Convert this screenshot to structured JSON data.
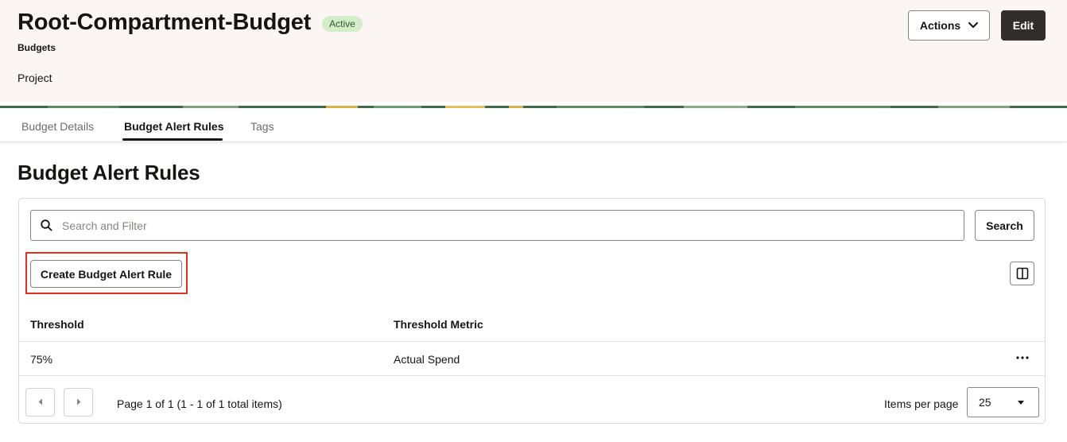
{
  "header": {
    "title": "Root-Compartment-Budget",
    "status_badge": "Active",
    "breadcrumb": "Budgets",
    "subtitle": "Project",
    "actions_label": "Actions",
    "edit_label": "Edit"
  },
  "tabs": [
    {
      "label": "Budget Details",
      "active": false
    },
    {
      "label": "Budget Alert Rules",
      "active": true
    },
    {
      "label": "Tags",
      "active": false
    }
  ],
  "section": {
    "title": "Budget Alert Rules"
  },
  "search": {
    "placeholder": "Search and Filter",
    "value": "",
    "button_label": "Search"
  },
  "toolbar": {
    "create_label": "Create Budget Alert Rule",
    "columns_icon": "columns-icon"
  },
  "table": {
    "columns": [
      "Threshold",
      "Threshold Metric"
    ],
    "rows": [
      {
        "threshold": "75%",
        "metric": "Actual Spend",
        "actions_icon": "kebab-menu-icon"
      }
    ]
  },
  "pagination": {
    "summary": "Page 1 of 1 (1 - 1 of 1 total items)",
    "items_per_page_label": "Items per page",
    "items_per_page_value": "25"
  },
  "colors": {
    "badge_bg": "#d4edc9",
    "badge_text": "#2e5a27",
    "header_bg": "#fbf6f4",
    "primary_button": "#312d2a",
    "highlight": "#e0321e"
  }
}
